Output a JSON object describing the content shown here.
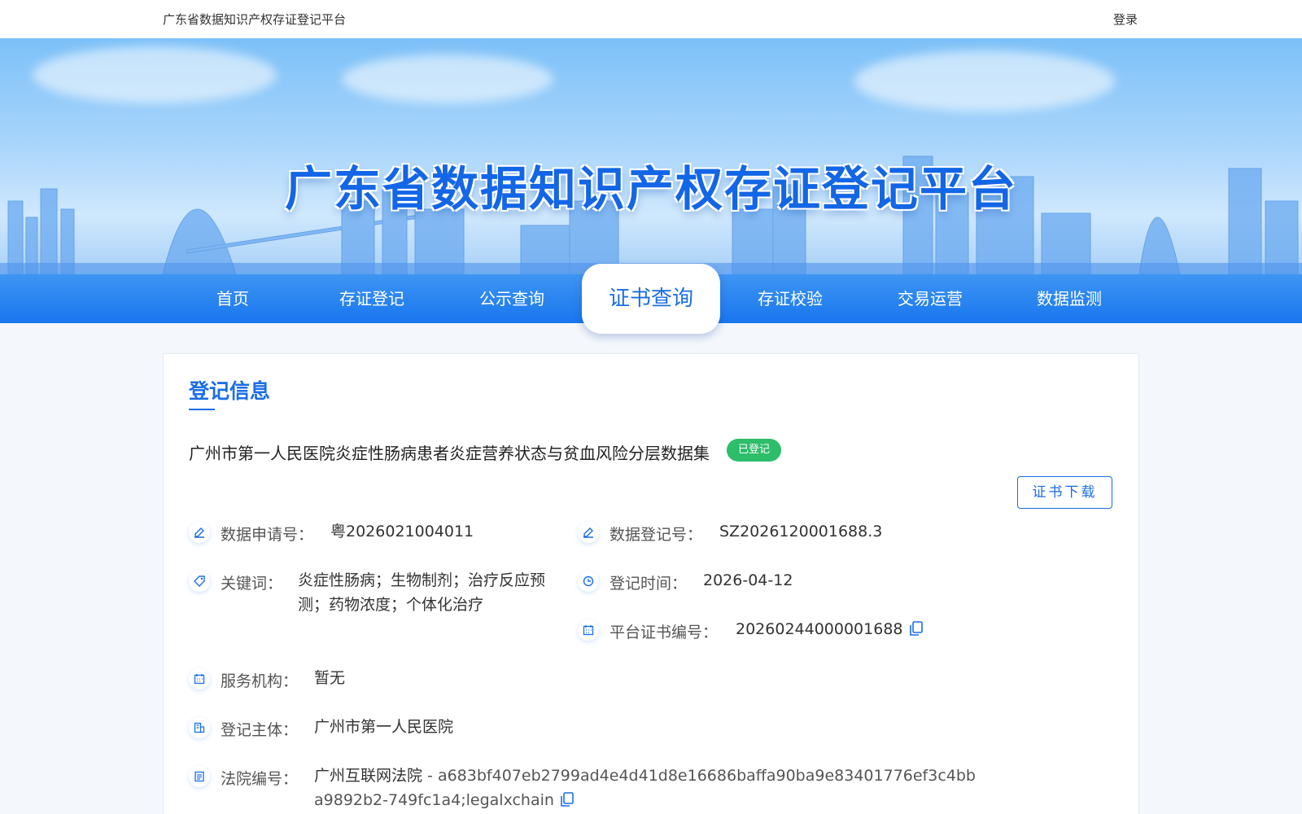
{
  "header": {
    "site_name": "广东省数据知识产权存证登记平台",
    "login_label": "登录"
  },
  "banner": {
    "title": "广东省数据知识产权存证登记平台"
  },
  "nav": {
    "items": [
      {
        "label": "首页"
      },
      {
        "label": "存证登记"
      },
      {
        "label": "公示查询"
      },
      {
        "label": "证书查询",
        "active": true
      },
      {
        "label": "存证校验"
      },
      {
        "label": "交易运营"
      },
      {
        "label": "数据监测"
      }
    ]
  },
  "registration": {
    "section_title": "登记信息",
    "dataset_title": "广州市第一人民医院炎症性肠病患者炎症营养状态与贫血风险分层数据集",
    "status_badge": "已登记",
    "cert_download_label": "证书下载",
    "fields": {
      "application_no": {
        "label": "数据申请号：",
        "value": "粤2026021004011",
        "icon": "edit-icon"
      },
      "registration_no": {
        "label": "数据登记号：",
        "value": "SZ2026120001688.3",
        "icon": "edit-icon"
      },
      "keywords": {
        "label": "关键词：",
        "value": "炎症性肠病；生物制剂；治疗反应预测；药物浓度；个体化治疗",
        "icon": "tag-icon"
      },
      "registration_time": {
        "label": "登记时间：",
        "value": "2026-04-12",
        "icon": "clock-icon"
      },
      "platform_cert_no": {
        "label": "平台证书编号：",
        "value": "20260244000001688",
        "icon": "calendar-icon"
      },
      "service_org": {
        "label": "服务机构：",
        "value": "暂无",
        "icon": "calendar-icon"
      },
      "registrant": {
        "label": "登记主体：",
        "value": "广州市第一人民医院",
        "icon": "building-icon"
      },
      "court_no": {
        "label": "法院编号：",
        "value_prefix": "广州互联网法院",
        "value": " - a683bf407eb2799ad4e4d41d8e16686baffa90ba9e83401776ef3c4bba9892b2-749fc1a4;legalxchain",
        "icon": "document-icon"
      }
    }
  },
  "colors": {
    "primary": "#1b6ee6",
    "nav_bg": "#1976ee",
    "badge_green": "#2ebd6b"
  }
}
